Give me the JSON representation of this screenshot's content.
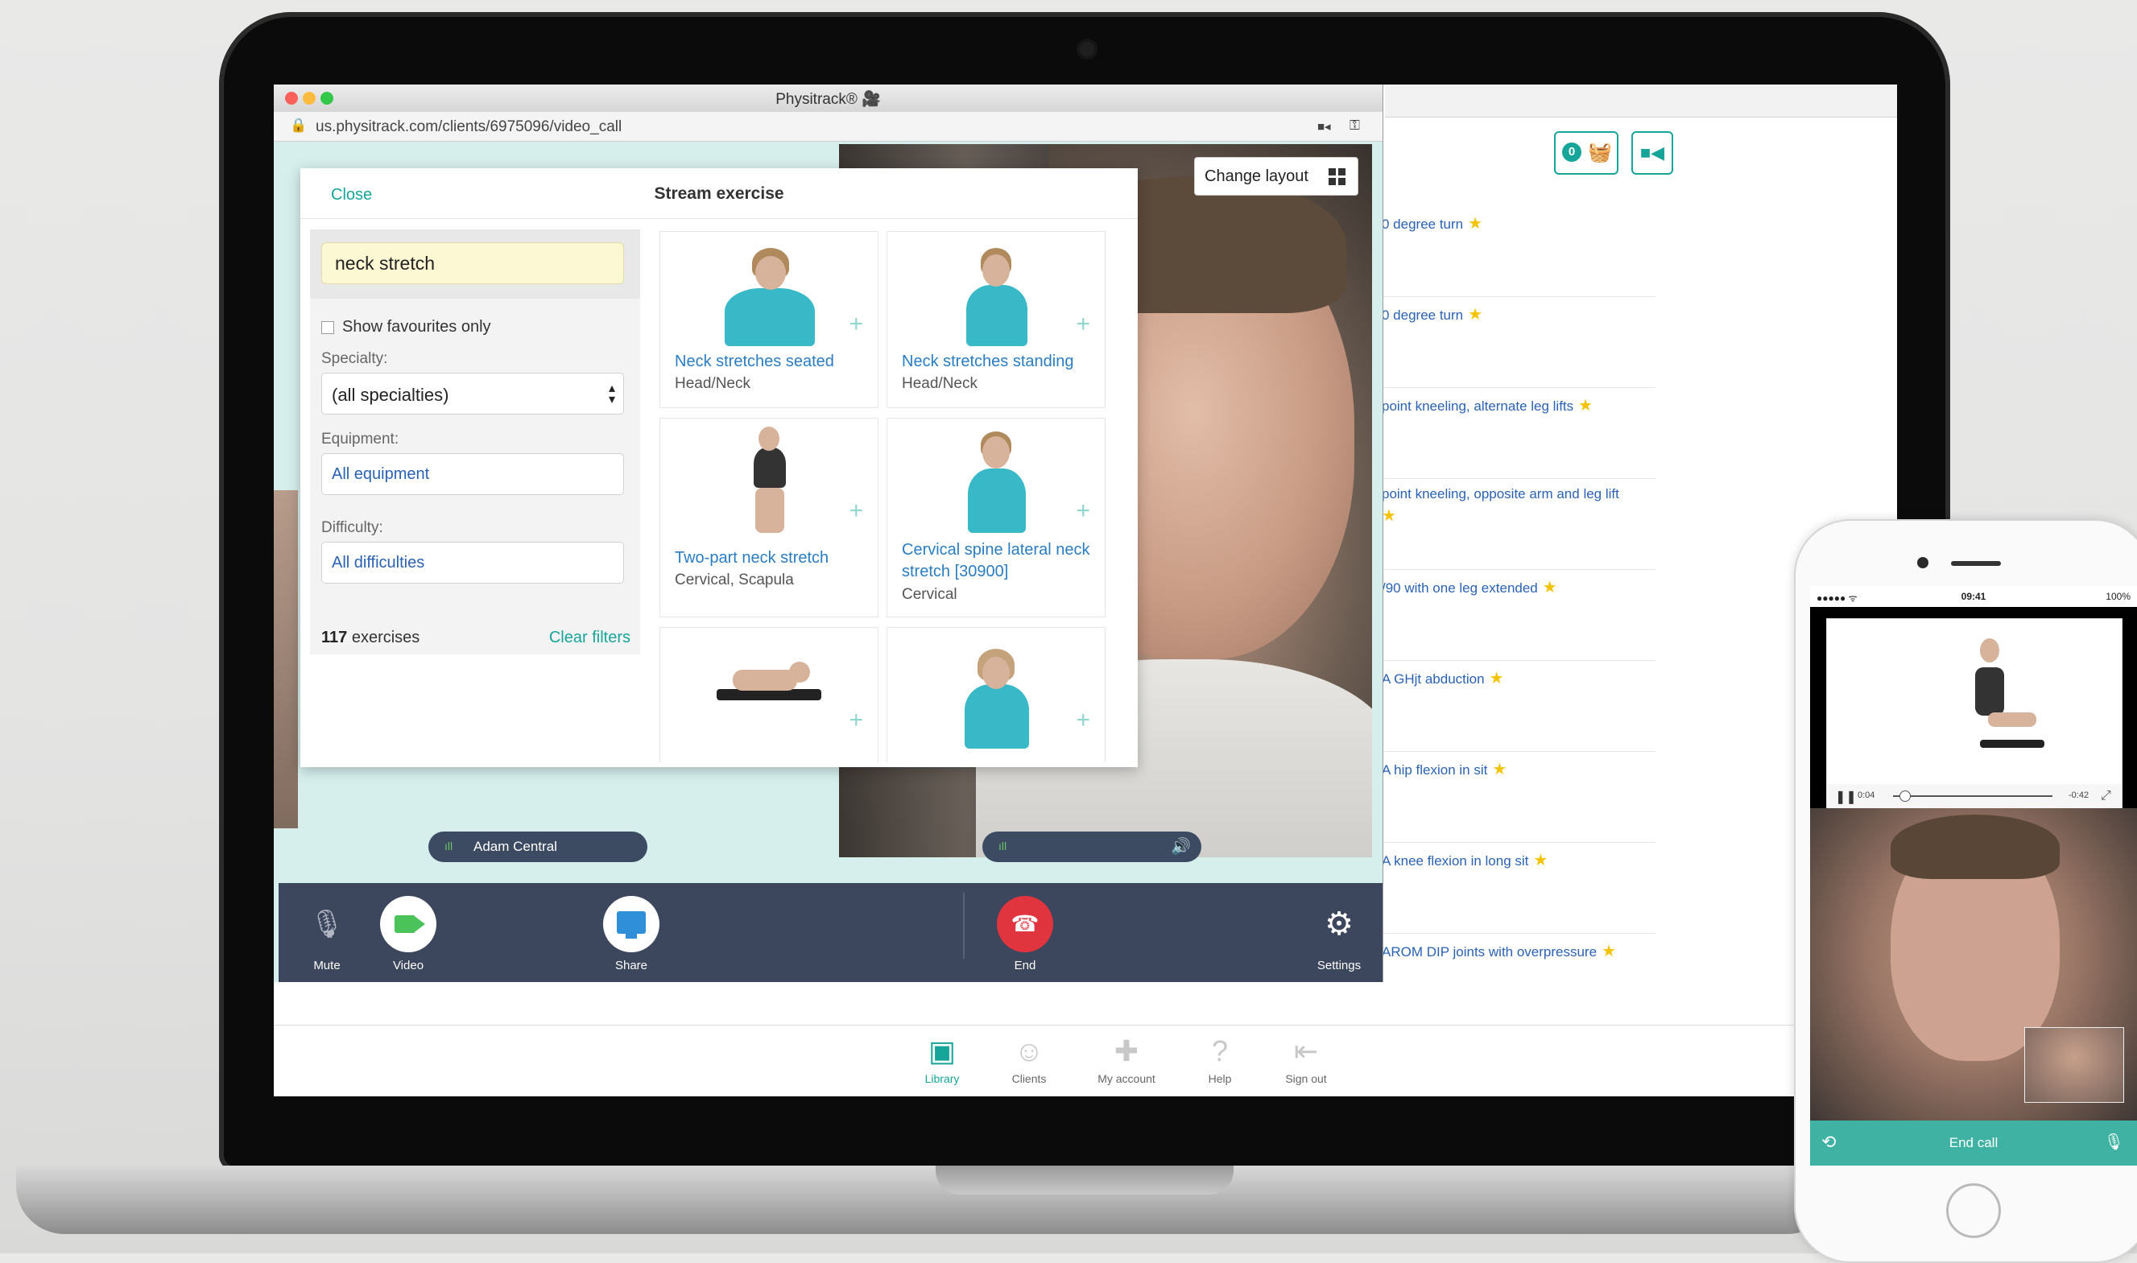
{
  "browser": {
    "window_title": "Physitrack® 🎥",
    "url": "us.physitrack.com/clients/6975096/video_call"
  },
  "modal": {
    "close_label": "Close",
    "title": "Stream exercise",
    "search_value": "neck stretch",
    "favourites_label": "Show favourites only",
    "specialty_label": "Specialty:",
    "specialty_value": "(all specialties)",
    "equipment_label": "Equipment:",
    "equipment_value": "All equipment",
    "difficulty_label": "Difficulty:",
    "difficulty_value": "All difficulties",
    "count_number": "117",
    "count_suffix": " exercises",
    "clear_filters_label": "Clear filters",
    "cards": [
      {
        "title": "Neck stretches seated",
        "subtitle": "Head/Neck"
      },
      {
        "title": "Neck stretches standing",
        "subtitle": "Head/Neck"
      },
      {
        "title": "Two-part neck stretch",
        "subtitle": "Cervical, Scapula"
      },
      {
        "title": "Cervical spine lateral neck stretch [30900]",
        "subtitle": "Cervical"
      },
      {
        "title": "",
        "subtitle": ""
      },
      {
        "title": "",
        "subtitle": ""
      }
    ]
  },
  "call": {
    "change_layout_label": "Change layout",
    "local_name": "Adam Central",
    "controls": {
      "mute": "Mute",
      "video": "Video",
      "share": "Share",
      "end": "End",
      "settings": "Settings"
    }
  },
  "background_app": {
    "basket_count": "0",
    "exercises": [
      "0 degree turn",
      "0 degree turn",
      "point kneeling, alternate leg lifts",
      "point kneeling, opposite arm and leg lift",
      "/90 with one leg extended",
      "A GHjt abduction",
      "A hip flexion in sit",
      "A knee flexion in long sit",
      "AROM DIP joints with overpressure"
    ],
    "nav": [
      "Library",
      "Clients",
      "My account",
      "Help",
      "Sign out"
    ]
  },
  "phone": {
    "status_left": "●●●●● ᯤ",
    "status_time": "09:41",
    "status_right": "100%",
    "elapsed": "0:04",
    "remaining": "-0:42",
    "end_call_label": "End call"
  },
  "colors": {
    "accent": "#17a59a",
    "link": "#2a62b4",
    "control_bar": "#3c465c",
    "end_red": "#e0353f",
    "share_blue": "#2f8fd8",
    "video_green": "#4cc35a"
  }
}
